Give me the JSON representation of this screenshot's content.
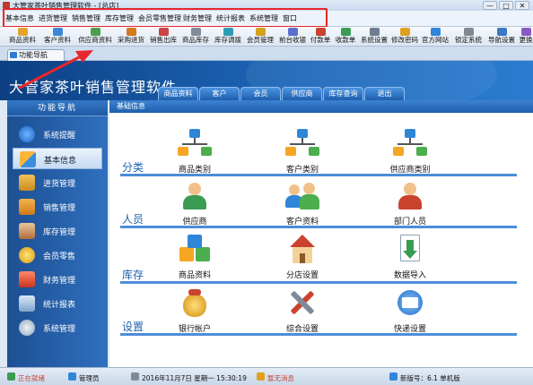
{
  "window": {
    "title": "大管家茶叶销售管理软件 - [总店]",
    "buttons": [
      "—",
      "□",
      "✕"
    ]
  },
  "menubar": [
    "基本信息",
    "进货管理",
    "销售管理",
    "库存管理",
    "会员零售管理",
    "财务管理",
    "统计报表",
    "系统管理",
    "窗口"
  ],
  "toolbar": [
    "商品资料",
    "客户资料",
    "供应商资料",
    "采购进货",
    "销售出库",
    "商品库存",
    "库存调拨",
    "会员管理",
    "前台收银",
    "付款单",
    "收款单",
    "系统设置",
    "修改密码",
    "官方网站",
    "锁定系统",
    "导航设置",
    "更换"
  ],
  "tab": {
    "nav": "功能导航"
  },
  "banner": {
    "title": "大管家茶叶销售管理软件",
    "tabs": [
      "商品资料",
      "客户",
      "会员",
      "供应商",
      "库存查询",
      "退出"
    ]
  },
  "sidebar": {
    "title": "功能导航",
    "items": [
      {
        "label": "系统提醒",
        "icon": "info-icon"
      },
      {
        "label": "基本信息",
        "icon": "cubes-icon"
      },
      {
        "label": "进货管理",
        "icon": "box-in-icon"
      },
      {
        "label": "销售管理",
        "icon": "box-out-icon"
      },
      {
        "label": "库存管理",
        "icon": "warehouse-icon"
      },
      {
        "label": "会员零售",
        "icon": "coins-icon"
      },
      {
        "label": "财务管理",
        "icon": "gift-icon"
      },
      {
        "label": "统计报表",
        "icon": "chart-icon"
      },
      {
        "label": "系统管理",
        "icon": "gears-icon"
      }
    ]
  },
  "main": {
    "header": "基础信息",
    "sections": [
      {
        "label": "分类",
        "items": [
          {
            "label": "商品类别",
            "icon": "tree-icon"
          },
          {
            "label": "客户类别",
            "icon": "tree-icon"
          },
          {
            "label": "供应商类别",
            "icon": "tree-icon"
          }
        ]
      },
      {
        "label": "人员",
        "items": [
          {
            "label": "供应商",
            "icon": "person-icon"
          },
          {
            "label": "客户资料",
            "icon": "people-icon"
          },
          {
            "label": "部门人员",
            "icon": "staff-icon"
          }
        ]
      },
      {
        "label": "库存",
        "items": [
          {
            "label": "商品资料",
            "icon": "cubes-icon"
          },
          {
            "label": "分店设置",
            "icon": "house-icon"
          },
          {
            "label": "数据导入",
            "icon": "import-icon"
          }
        ]
      },
      {
        "label": "设置",
        "items": [
          {
            "label": "银行帐户",
            "icon": "money-bag-icon"
          },
          {
            "label": "综合设置",
            "icon": "tools-icon"
          },
          {
            "label": "快递设置",
            "icon": "mail-icon"
          }
        ]
      }
    ]
  },
  "statusbar": {
    "login": "正在就绪",
    "user": "管理员",
    "datetime": "2016年11月7日  星期一  15:30:19",
    "message": "暂无消息",
    "version": "新版号：6.1  单机版"
  }
}
